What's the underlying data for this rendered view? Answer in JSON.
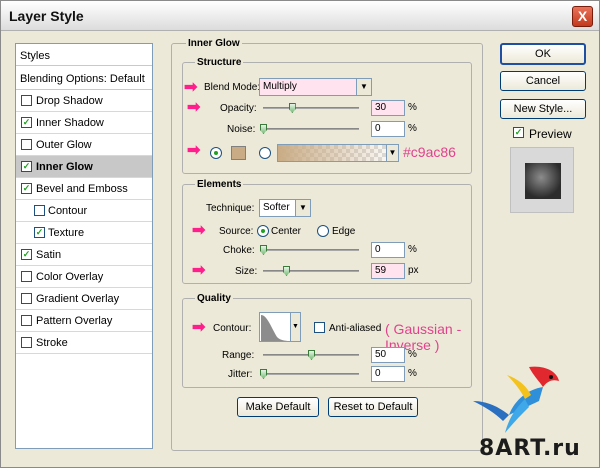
{
  "window": {
    "title": "Layer Style",
    "close_glyph": "X"
  },
  "styles_panel": {
    "header": "Styles",
    "blending": "Blending Options: Default",
    "items": [
      {
        "label": "Drop Shadow",
        "checked": false,
        "sub": false,
        "active": false
      },
      {
        "label": "Inner Shadow",
        "checked": true,
        "sub": false,
        "active": false
      },
      {
        "label": "Outer Glow",
        "checked": false,
        "sub": false,
        "active": false
      },
      {
        "label": "Inner Glow",
        "checked": true,
        "sub": false,
        "active": true
      },
      {
        "label": "Bevel and Emboss",
        "checked": true,
        "sub": false,
        "active": false
      },
      {
        "label": "Contour",
        "checked": false,
        "sub": true,
        "active": false
      },
      {
        "label": "Texture",
        "checked": true,
        "sub": true,
        "active": false
      },
      {
        "label": "Satin",
        "checked": true,
        "sub": false,
        "active": false
      },
      {
        "label": "Color Overlay",
        "checked": false,
        "sub": false,
        "active": false
      },
      {
        "label": "Gradient Overlay",
        "checked": false,
        "sub": false,
        "active": false
      },
      {
        "label": "Pattern Overlay",
        "checked": false,
        "sub": false,
        "active": false
      },
      {
        "label": "Stroke",
        "checked": false,
        "sub": false,
        "active": false
      }
    ]
  },
  "inner_glow": {
    "title": "Inner Glow",
    "structure": {
      "title": "Structure",
      "blend_mode_label": "Blend Mode:",
      "blend_mode": "Multiply",
      "opacity_label": "Opacity:",
      "opacity": "30",
      "opacity_level": 0.3,
      "noise_label": "Noise:",
      "noise": "0",
      "noise_level": 0,
      "percent": "%",
      "color": "#c9ac86",
      "color_annotation": "#c9ac86"
    },
    "elements": {
      "title": "Elements",
      "technique_label": "Technique:",
      "technique": "Softer",
      "source_label": "Source:",
      "center_label": "Center",
      "edge_label": "Edge",
      "choke_label": "Choke:",
      "choke": "0",
      "choke_level": 0,
      "size_label": "Size:",
      "size": "59",
      "size_level": 0.24,
      "percent": "%",
      "px": "px"
    },
    "quality": {
      "title": "Quality",
      "contour_label": "Contour:",
      "anti_aliased_label": "Anti-aliased",
      "contour_annotation": "( Gaussian - Inverse )",
      "range_label": "Range:",
      "range": "50",
      "range_level": 0.5,
      "jitter_label": "Jitter:",
      "jitter": "0",
      "jitter_level": 0,
      "percent": "%"
    },
    "make_default": "Make Default",
    "reset_to_default": "Reset to Default"
  },
  "buttons": {
    "ok": "OK",
    "cancel": "Cancel",
    "new_style": "New Style...",
    "preview": "Preview"
  },
  "watermark": {
    "text": "8ART.ru"
  },
  "colors": {
    "accent_pink": "#ff1f8c",
    "annotation": "#e0428d",
    "glow": "#c9ac86"
  }
}
